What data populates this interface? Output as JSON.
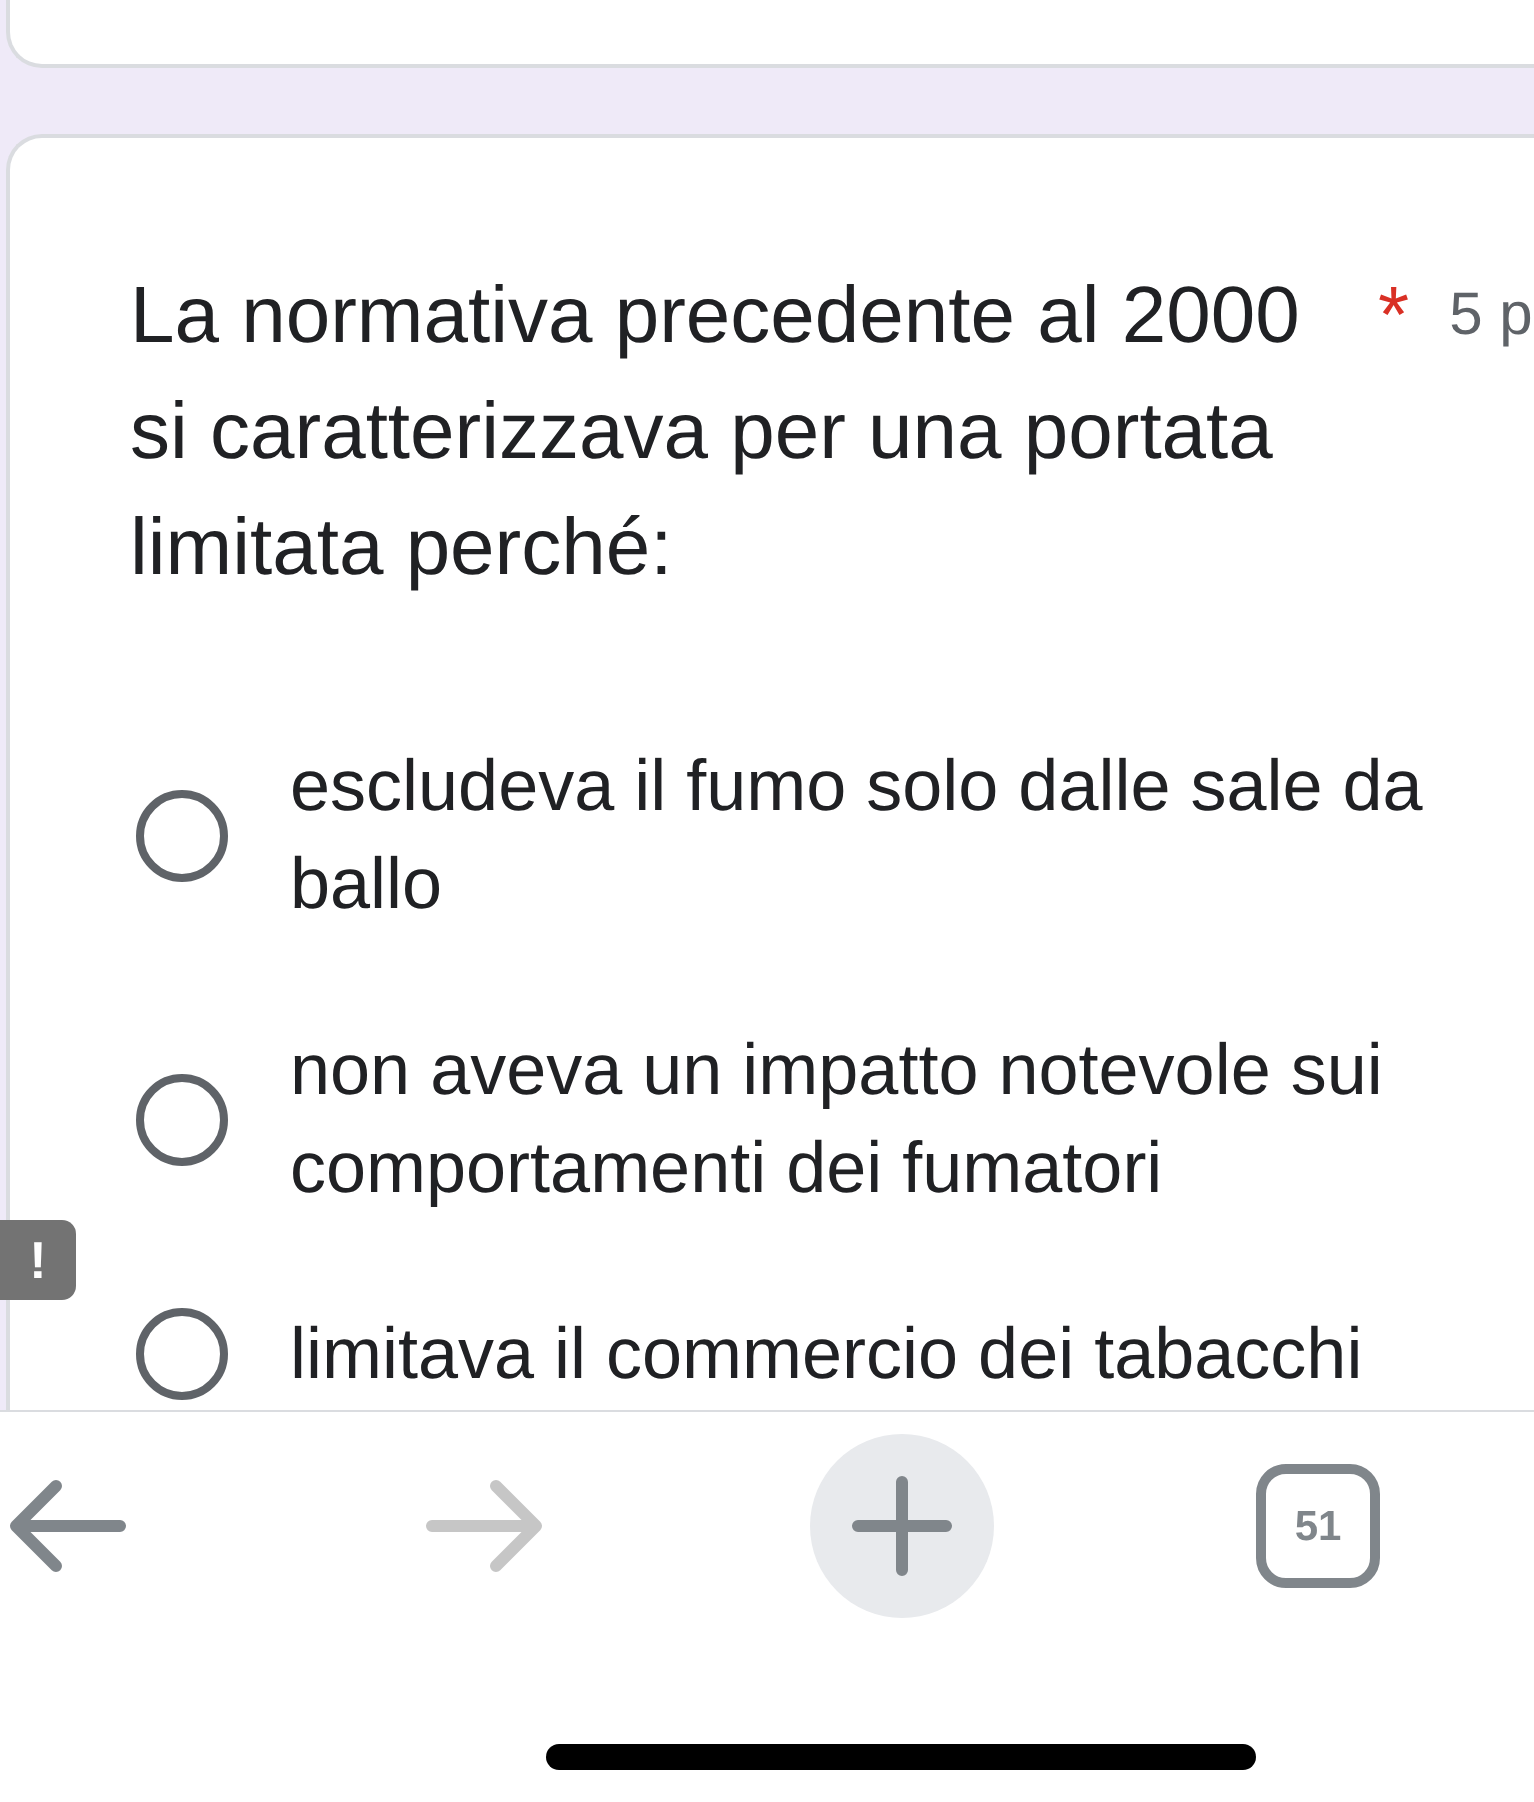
{
  "question": {
    "text": "La normativa precedente al 2000 si caratterizzava per una portata limitata perché:",
    "required_mark": "*",
    "points": "5 p"
  },
  "options": [
    {
      "label": "escludeva il fumo solo dalle sale da ballo",
      "selected": false
    },
    {
      "label": "non aveva un impatto notevole sui comportamenti dei fumatori",
      "selected": false
    },
    {
      "label": "limitava il commercio dei tabacchi",
      "selected": false
    }
  ],
  "alert_badge": {
    "text": "!"
  },
  "browser_toolbar": {
    "back": {
      "disabled": false
    },
    "forward": {
      "disabled": true
    },
    "tab_count": "51"
  }
}
